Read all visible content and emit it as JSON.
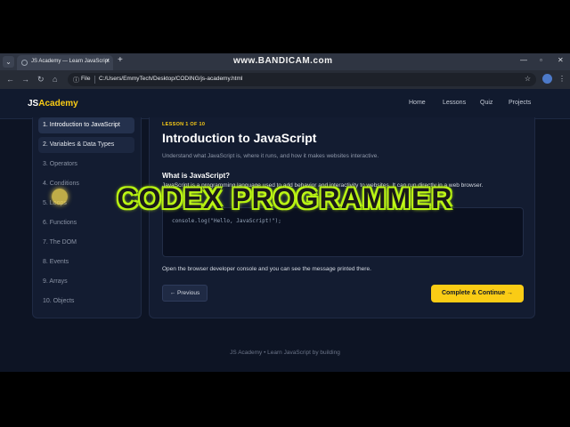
{
  "browser": {
    "tab_title": "JS Academy — Learn JavaScript",
    "tab_close": "×",
    "new_tab": "+",
    "watermark": "www.BANDICAM.com",
    "win_min": "—",
    "win_max": "▫",
    "win_close": "✕",
    "back": "←",
    "forward": "→",
    "reload": "↻",
    "home": "⌂",
    "address_scheme": "File",
    "address_url": "C:/Users/EmmyTech/Desktop/CODING/js-academy.html",
    "star": "☆",
    "menu": "⋮"
  },
  "site": {
    "logo_prefix": "JS",
    "logo_accent": "Academy",
    "nav": [
      "Home",
      "Lessons",
      "Quiz",
      "Projects"
    ]
  },
  "sidebar": {
    "items": [
      "1. Introduction to JavaScript",
      "2. Variables & Data Types",
      "3. Operators",
      "4. Conditions",
      "5. Loops",
      "6. Functions",
      "7. The DOM",
      "8. Events",
      "9. Arrays",
      "10. Objects"
    ],
    "active_index": 0
  },
  "lesson": {
    "tag": "LESSON 1 OF 10",
    "title": "Introduction to JavaScript",
    "subtitle": "Understand what JavaScript is, where it runs, and how it makes websites interactive.",
    "section_title": "What is JavaScript?",
    "section_body": "JavaScript is a programming language used to add behavior and interactivity to websites. It can run directly in a web browser.",
    "code": "console.log(\"Hello, JavaScript!\");",
    "console_note": "Open the browser developer console and you can see the message printed there.",
    "prev_label": "← Previous",
    "next_label": "Complete & Continue →"
  },
  "overlay_text": "CODEX PROGRAMMER",
  "footer": "JS Academy • Learn JavaScript by building",
  "colors": {
    "accent": "#facc15",
    "background": "#0d1424",
    "panel": "#131c31",
    "overlay_glow": "#c8ff1e"
  }
}
